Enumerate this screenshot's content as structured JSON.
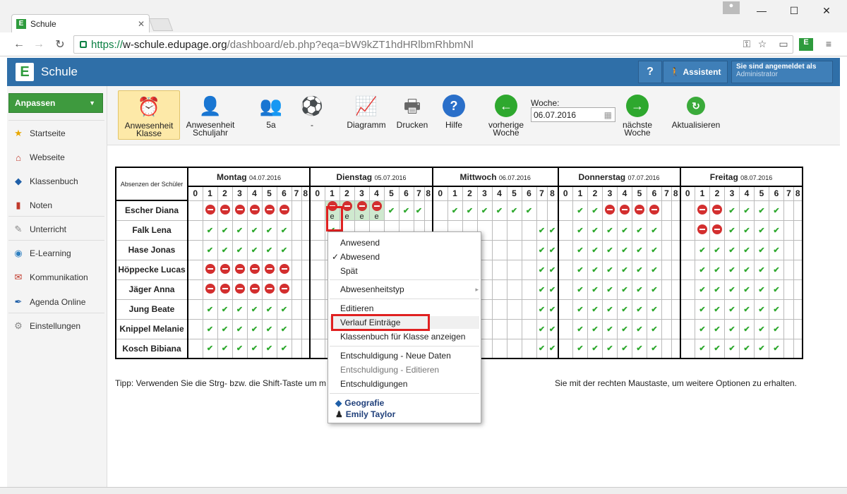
{
  "browser": {
    "tab_title": "Schule",
    "url_scheme": "https://",
    "url_host": "w-schule.edupage.org",
    "url_path": "/dashboard/eb.php?eqa=bW9kZT1hdHRlbmRhbmNl"
  },
  "app": {
    "favicon_letter": "E",
    "brand": "Schule",
    "help_label": "?",
    "assistant_label": "Assistent",
    "login_title": "Sie sind angemeldet als",
    "login_user": "Administrator",
    "accent": "#2f6fa8",
    "green": "#3e9a3e"
  },
  "sidebar": {
    "customize": "Anpassen",
    "items": [
      {
        "label": "Startseite",
        "icon": "star-icon"
      },
      {
        "label": "Webseite",
        "icon": "house-icon"
      },
      {
        "label": "Klassenbuch",
        "icon": "book-icon"
      },
      {
        "label": "Noten",
        "icon": "notes-icon"
      },
      {
        "label": "Unterricht",
        "icon": "lesson-icon"
      },
      {
        "label": "E-Learning",
        "icon": "elearning-icon"
      },
      {
        "label": "Kommunikation",
        "icon": "communication-icon"
      },
      {
        "label": "Agenda Online",
        "icon": "pen-icon"
      },
      {
        "label": "Einstellungen",
        "icon": "settings-icon"
      }
    ]
  },
  "toolbar": {
    "attendance_class_1": "Anwesenheit",
    "attendance_class_2": "Klasse",
    "attendance_year_1": "Anwesenheit",
    "attendance_year_2": "Schuljahr",
    "class": "5a",
    "subject": "-",
    "diagram": "Diagramm",
    "print": "Drucken",
    "help": "Hilfe",
    "prev_1": "vorherige",
    "prev_2": "Woche",
    "week_label": "Woche:",
    "week_value": "06.07.2016",
    "next_1": "nächste",
    "next_2": "Woche",
    "refresh": "Aktualisieren"
  },
  "grid": {
    "header": "Absenzen der Schüler",
    "days": [
      {
        "name": "Montag",
        "date": "04.07.2016"
      },
      {
        "name": "Dienstag",
        "date": "05.07.2016"
      },
      {
        "name": "Mittwoch",
        "date": "06.07.2016"
      },
      {
        "name": "Donnerstag",
        "date": "07.07.2016"
      },
      {
        "name": "Freitag",
        "date": "08.07.2016"
      }
    ],
    "hours": [
      "0",
      "1",
      "2",
      "3",
      "4",
      "5",
      "6",
      "7",
      "8"
    ],
    "students": [
      {
        "name": "Escher Diana",
        "days": [
          "-AAAAAA--",
          "-AAAAPPP-",
          "-PPPPPP--",
          "-PPAAAA--",
          "-AAPPPP--"
        ],
        "excused_hours": "-eeee----"
      },
      {
        "name": "Falk Lena",
        "days": [
          "-PPPPPP--",
          "-P-------",
          "-------PP",
          "-PPPPPP--",
          "-AAPPPP--"
        ]
      },
      {
        "name": "Hase Jonas",
        "days": [
          "-PPPPPP--",
          "-P-------",
          "-------PP",
          "-PPPPPP--",
          "-PPPPPP--"
        ]
      },
      {
        "name": "Höppecke Lucas",
        "days": [
          "-AAAAAA--",
          "-P-------",
          "-------PP",
          "-PPPPPP--",
          "-PPPPPP--"
        ]
      },
      {
        "name": "Jäger Anna",
        "days": [
          "-AAAAAA--",
          "-P-------",
          "-------PP",
          "-PPPPPP--",
          "-PPPPPP--"
        ]
      },
      {
        "name": "Jung Beate",
        "days": [
          "-PPPPPP--",
          "-P-------",
          "-------PP",
          "-PPPPPP--",
          "-PPPPPP--"
        ]
      },
      {
        "name": "Knippel Melanie",
        "days": [
          "-PPPPPP--",
          "-P-------",
          "-------PP",
          "-PPPPPP--",
          "-PPPPPP--"
        ]
      },
      {
        "name": "Kosch Bibiana",
        "days": [
          "-PPPPPP--",
          "-P-------",
          "-------PP",
          "-PPPPPP--",
          "-PPPPPP--"
        ]
      }
    ]
  },
  "tip": {
    "left": "Tipp: Verwenden Sie die Strg- bzw. die Shift-Taste um m",
    "right": "Sie mit der rechten Maustaste, um weitere Optionen zu erhalten."
  },
  "context_menu": {
    "present": "Anwesend",
    "absent": "Abwesend",
    "absent_checked": "✓",
    "late": "Spät",
    "absence_type": "Abwesenheitstyp",
    "edit": "Editieren",
    "history": "Verlauf Einträge",
    "class_book": "Klassenbuch für Klasse anzeigen",
    "excuse_new": "Entschuldigung - Neue Daten",
    "excuse_edit": "Entschuldigung - Editieren",
    "excuses": "Entschuldigungen",
    "subject": "Geografie",
    "teacher": "Emily Taylor"
  }
}
